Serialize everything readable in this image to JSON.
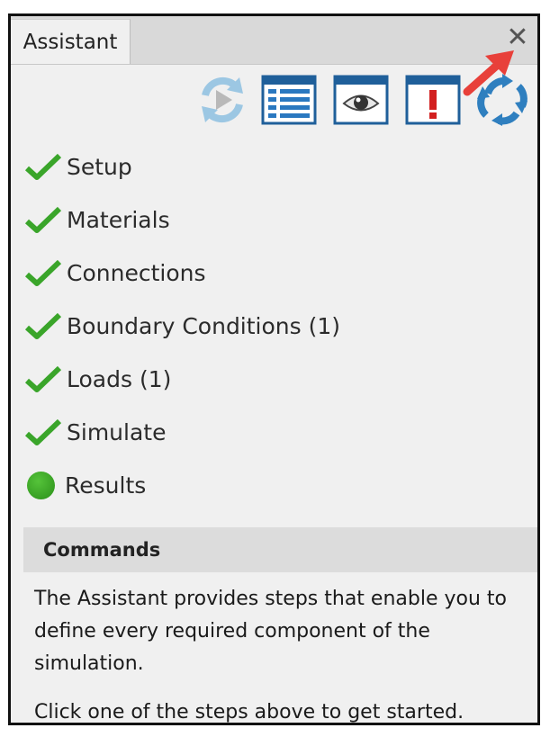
{
  "panel": {
    "tab_label": "Assistant",
    "close_glyph": "✕"
  },
  "toolbar": {
    "buttons": [
      {
        "icon": "play-refresh-icon"
      },
      {
        "icon": "list-view-icon"
      },
      {
        "icon": "eye-icon"
      },
      {
        "icon": "warning-icon"
      },
      {
        "icon": "update-cycle-icon"
      }
    ]
  },
  "steps": [
    {
      "label": "Setup",
      "status": "complete"
    },
    {
      "label": "Materials",
      "status": "complete"
    },
    {
      "label": "Connections",
      "status": "complete"
    },
    {
      "label": "Boundary Conditions (1)",
      "status": "complete"
    },
    {
      "label": "Loads (1)",
      "status": "complete"
    },
    {
      "label": "Simulate",
      "status": "complete"
    },
    {
      "label": "Results",
      "status": "active"
    }
  ],
  "commands": {
    "title": "Commands",
    "paragraph1": "The Assistant provides steps that enable you to define every required component of the simulation.",
    "paragraph2": "Click one of the steps above to get started."
  },
  "colors": {
    "check_green": "#3aa52a",
    "dot_green": "#2a8f19",
    "annotation_arrow": "#e8403a",
    "icon_blue": "#2f7fbf"
  }
}
